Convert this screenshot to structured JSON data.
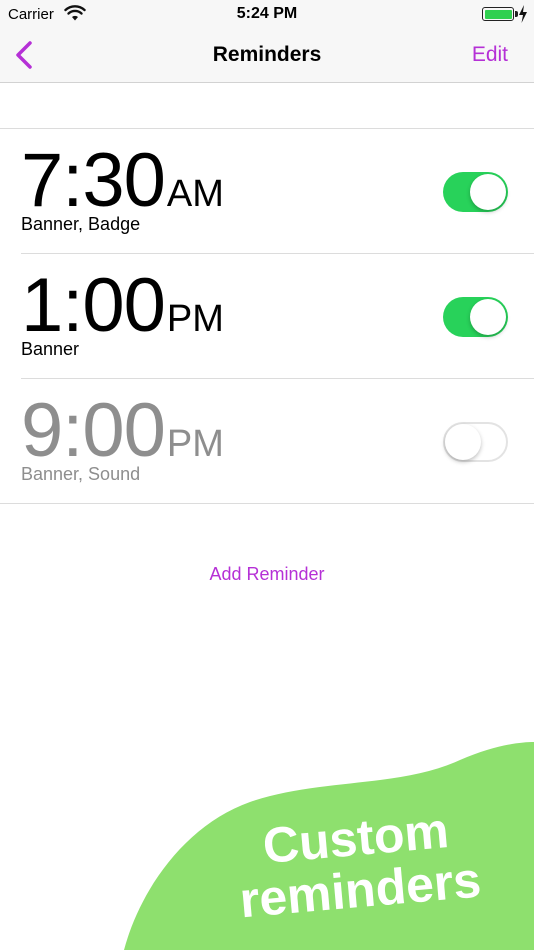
{
  "status_bar": {
    "carrier": "Carrier",
    "time": "5:24 PM",
    "wifi_icon": "wifi-icon",
    "battery_icon": "battery-icon",
    "charging_icon": "lightning-bolt-icon",
    "battery_color": "#2fd04f"
  },
  "nav": {
    "back_icon": "chevron-left-icon",
    "title": "Reminders",
    "edit_label": "Edit"
  },
  "reminders": [
    {
      "time": "7:30",
      "period": "AM",
      "detail": "Banner, Badge",
      "enabled": true
    },
    {
      "time": "1:00",
      "period": "PM",
      "detail": "Banner",
      "enabled": true
    },
    {
      "time": "9:00",
      "period": "PM",
      "detail": "Banner, Sound",
      "enabled": false
    }
  ],
  "add_reminder_label": "Add Reminder",
  "promo": {
    "line1": "Custom",
    "line2": "reminders",
    "blob_color": "#8ee06e"
  },
  "colors": {
    "accent": "#b530d6",
    "toggle_on": "#28d25a",
    "disabled_text": "#8e8e8e"
  }
}
